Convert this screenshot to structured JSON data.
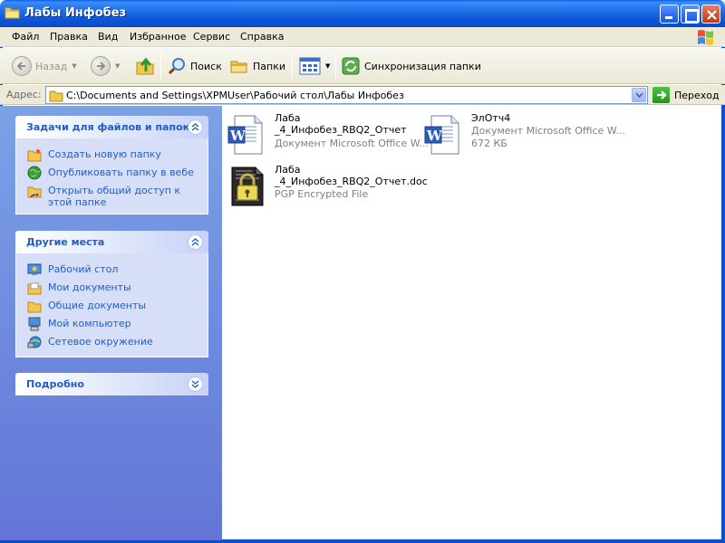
{
  "window": {
    "title": "Лабы Инфобез",
    "title_color": "#0b4fd1"
  },
  "menu": {
    "items": [
      "Файл",
      "Правка",
      "Вид",
      "Избранное",
      "Сервис",
      "Справка"
    ]
  },
  "toolbar": {
    "back_label": "Назад",
    "search_label": "Поиск",
    "folders_label": "Папки",
    "sync_label": "Синхронизация папки"
  },
  "address": {
    "label": "Адрес:",
    "value": "C:\\Documents and Settings\\XPMUser\\Рабочий стол\\Лабы Инфобез",
    "go_label": "Переход"
  },
  "tasks_panel": {
    "title": "Задачи для файлов и папок",
    "items": [
      {
        "label": "Создать новую папку",
        "icon": "new-folder-icon"
      },
      {
        "label": "Опубликовать папку в вебе",
        "icon": "publish-web-icon"
      },
      {
        "label": "Открыть общий доступ к этой папке",
        "icon": "share-folder-icon"
      }
    ]
  },
  "places_panel": {
    "title": "Другие места",
    "items": [
      {
        "label": "Рабочий стол",
        "icon": "desktop-icon"
      },
      {
        "label": "Мои документы",
        "icon": "my-documents-icon"
      },
      {
        "label": "Общие документы",
        "icon": "shared-documents-icon"
      },
      {
        "label": "Мой компьютер",
        "icon": "my-computer-icon"
      },
      {
        "label": "Сетевое окружение",
        "icon": "network-places-icon"
      }
    ]
  },
  "details_panel": {
    "title": "Подробно"
  },
  "files": [
    {
      "name_line1": "Лаба",
      "name_line2": "_4_Инфобез_RBQ2_Отчет",
      "desc": "Документ Microsoft Office W...",
      "icon": "word-document-icon"
    },
    {
      "name_line1": "ЭлОтч4",
      "name_line2": "",
      "desc": "Документ Microsoft Office W...",
      "size": "672 КБ",
      "icon": "word-document-icon"
    },
    {
      "name_line1": "Лаба",
      "name_line2": "_4_Инфобез_RBQ2_Отчет.doc",
      "desc": "PGP Encrypted File",
      "icon": "pgp-locked-file-icon"
    }
  ]
}
